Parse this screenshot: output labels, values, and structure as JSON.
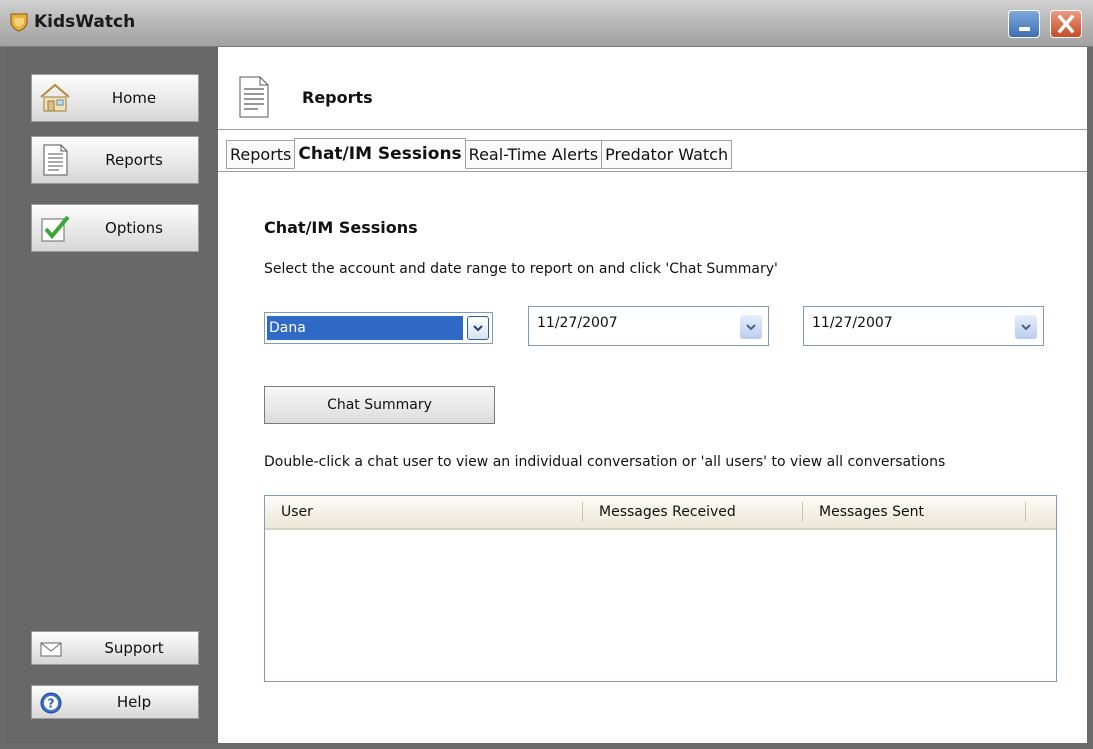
{
  "window": {
    "title": "KidsWatch",
    "app_icon": "shield-icon"
  },
  "sidebar": {
    "items": [
      {
        "label": "Home",
        "icon": "house-icon"
      },
      {
        "label": "Reports",
        "icon": "document-icon"
      },
      {
        "label": "Options",
        "icon": "checkmark-icon"
      },
      {
        "label": "Support",
        "icon": "envelope-icon"
      },
      {
        "label": "Help",
        "icon": "help-icon"
      }
    ]
  },
  "header": {
    "title": "Reports",
    "icon": "document-icon"
  },
  "tabs": [
    {
      "label": "Reports",
      "active": false
    },
    {
      "label": "Chat/IM Sessions",
      "active": true
    },
    {
      "label": "Real-Time Alerts",
      "active": false
    },
    {
      "label": "Predator Watch",
      "active": false
    }
  ],
  "main": {
    "section_title": "Chat/IM Sessions",
    "instruction": "Select the account and date range to report on and click 'Chat Summary'",
    "account": {
      "selected": "Dana"
    },
    "date_from": "11/27/2007",
    "date_to": "11/27/2007",
    "summary_button": "Chat Summary",
    "list_instruction": "Double-click a chat user to view an individual conversation or 'all users' to view all conversations",
    "table": {
      "columns": [
        "User",
        "Messages Received",
        "Messages Sent"
      ],
      "rows": []
    }
  },
  "colors": {
    "selection": "#3169c6",
    "sidebar_bg": "#686868",
    "border_blue": "#7f9db9"
  }
}
